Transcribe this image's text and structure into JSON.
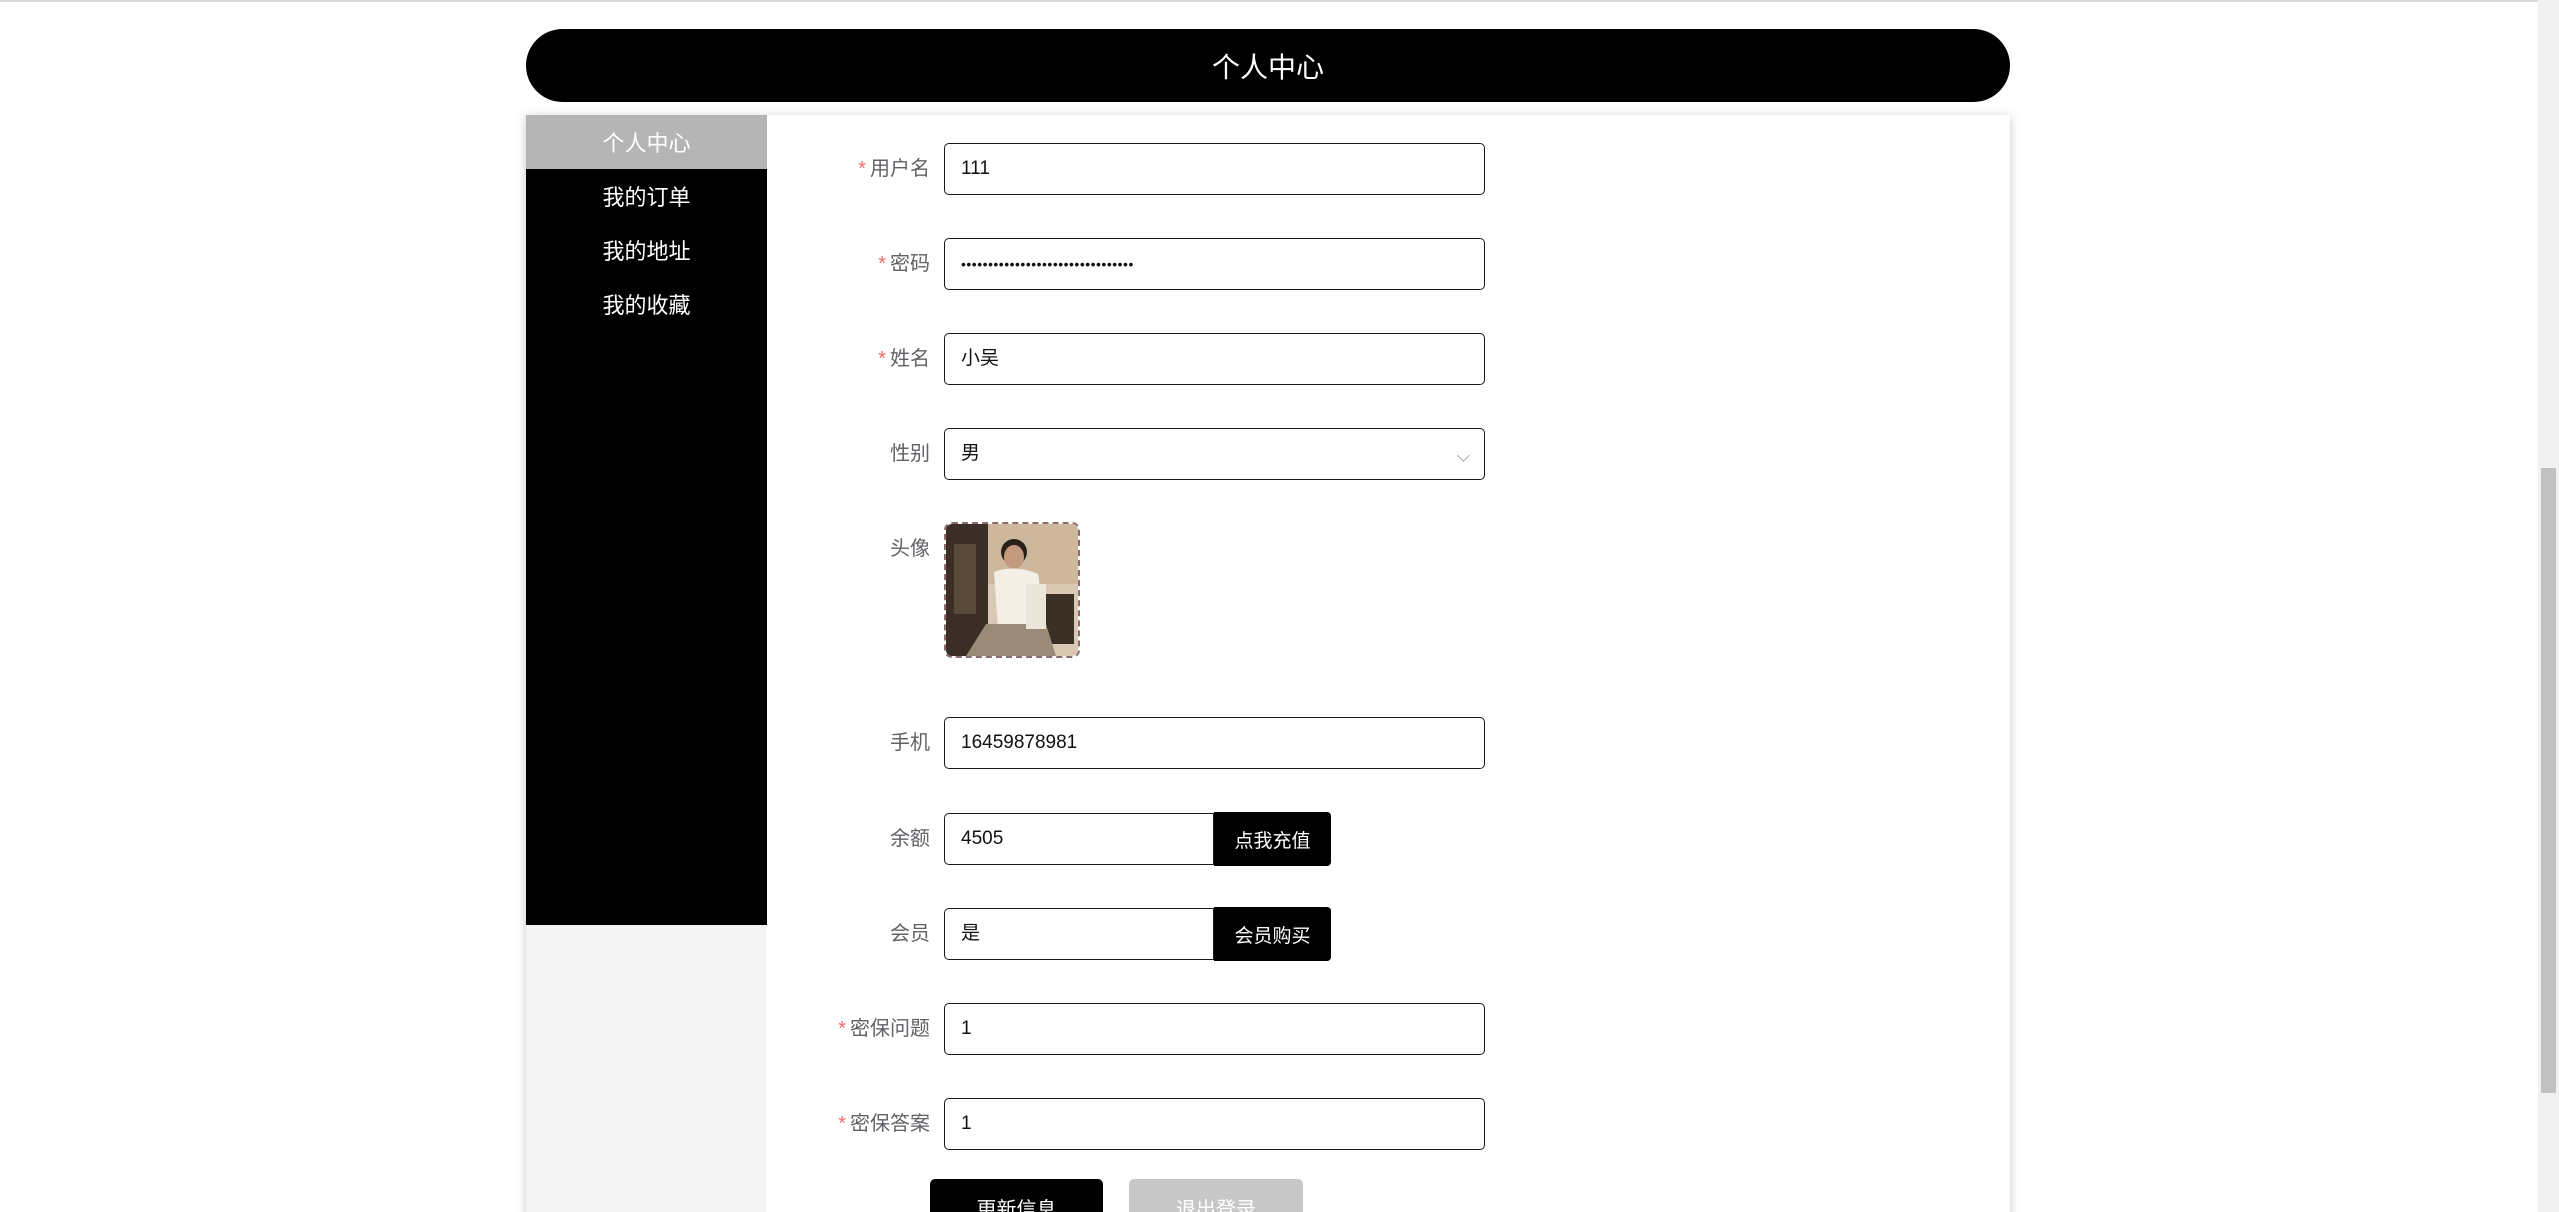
{
  "header": {
    "title": "个人中心"
  },
  "sidebar": {
    "items": [
      {
        "label": "个人中心",
        "active": true
      },
      {
        "label": "我的订单"
      },
      {
        "label": "我的地址"
      },
      {
        "label": "我的收藏"
      }
    ]
  },
  "form": {
    "username": {
      "label": "用户名",
      "required": "*",
      "value": "111"
    },
    "password": {
      "label": "密码",
      "required": "*",
      "value": "••••••••••••••••••••••••••••••••"
    },
    "name": {
      "label": "姓名",
      "required": "*",
      "value": "小吴"
    },
    "gender": {
      "label": "性别",
      "value": "男"
    },
    "avatar": {
      "label": "头像"
    },
    "phone": {
      "label": "手机",
      "value": "16459878981"
    },
    "balance": {
      "label": "余额",
      "value": "4505",
      "button": "点我充值"
    },
    "member": {
      "label": "会员",
      "value": "是",
      "button": "会员购买"
    },
    "question": {
      "label": "密保问题",
      "required": "*",
      "value": "1"
    },
    "answer": {
      "label": "密保答案",
      "required": "*",
      "value": "1"
    }
  },
  "actions": {
    "update": "更新信息",
    "logout": "退出登录"
  },
  "colors": {
    "accent": "#000000",
    "required": "#f56c6c",
    "sidebar_active": "#b5b5b5"
  }
}
